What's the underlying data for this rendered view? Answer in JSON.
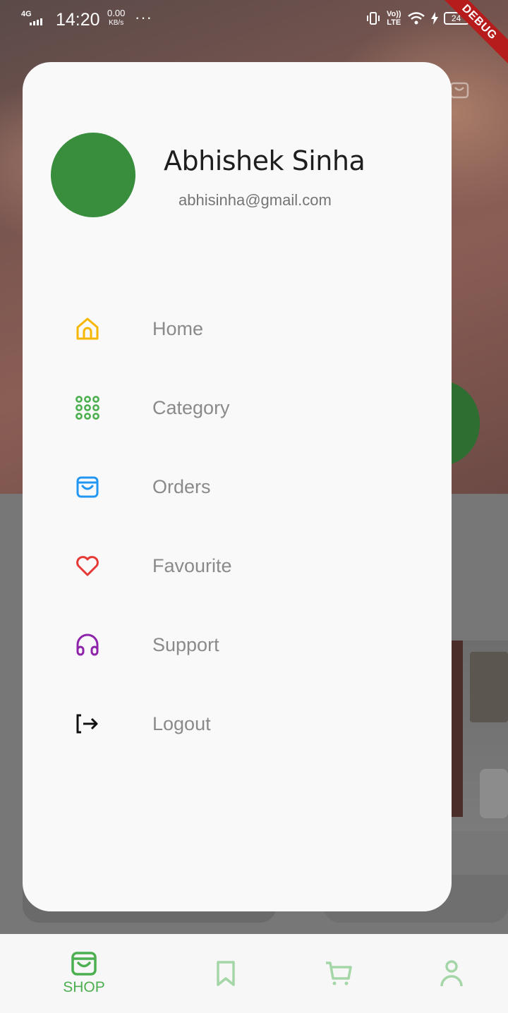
{
  "status_bar": {
    "network": "4G",
    "time": "14:20",
    "speed_value": "0.00",
    "speed_unit": "KB/s",
    "more": "···",
    "volte_top": "Vo))",
    "volte_bottom": "LTE",
    "battery": "24",
    "debug_label": "DEBUG"
  },
  "drawer": {
    "user": {
      "name": "Abhishek Sinha",
      "email": "abhisinha@gmail.com",
      "avatar_color": "#388e3c"
    },
    "menu_items": [
      {
        "label": "Home",
        "icon": "home-icon",
        "icon_color": "#f5b700"
      },
      {
        "label": "Category",
        "icon": "grid-dots-icon",
        "icon_color": "#4caf50"
      },
      {
        "label": "Orders",
        "icon": "shopping-bag-icon",
        "icon_color": "#2196f3"
      },
      {
        "label": "Favourite",
        "icon": "heart-icon",
        "icon_color": "#e53935"
      },
      {
        "label": "Support",
        "icon": "headphones-icon",
        "icon_color": "#8e24aa"
      },
      {
        "label": "Logout",
        "icon": "logout-icon",
        "icon_color": "#111111"
      }
    ]
  },
  "bottom_nav": {
    "items": [
      {
        "label": "SHOP",
        "icon": "shopping-bag-icon",
        "active": true
      },
      {
        "label": "",
        "icon": "bookmark-icon",
        "active": false
      },
      {
        "label": "",
        "icon": "cart-icon",
        "active": false
      },
      {
        "label": "",
        "icon": "profile-icon",
        "active": false
      }
    ],
    "active_color": "#4caf50",
    "inactive_color": "#a5d6a7"
  }
}
